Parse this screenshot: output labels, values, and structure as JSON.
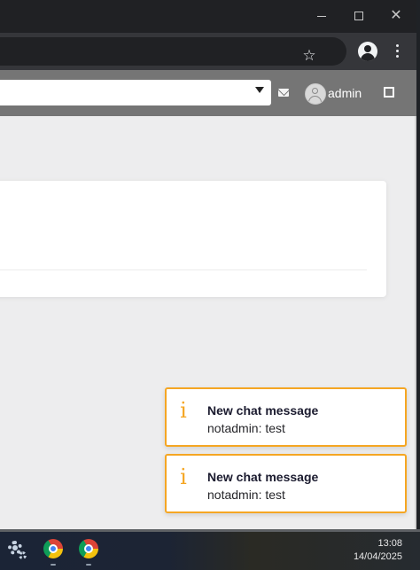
{
  "browser": {
    "window_controls": {
      "minimize": "minimize",
      "maximize": "maximize",
      "close": "✕"
    },
    "toolbar": {
      "star_icon": "☆"
    }
  },
  "app": {
    "header": {
      "username": "admin"
    }
  },
  "notifications": [
    {
      "title": "New chat message",
      "message": "notadmin: test",
      "icon": "i"
    },
    {
      "title": "New chat message",
      "message": "notadmin: test",
      "icon": "i"
    }
  ],
  "taskbar": {
    "time": "13:08",
    "date": "14/04/2025"
  },
  "colors": {
    "toast_border": "#f5a623",
    "app_header": "#757575",
    "browser_frame": "#202124"
  }
}
